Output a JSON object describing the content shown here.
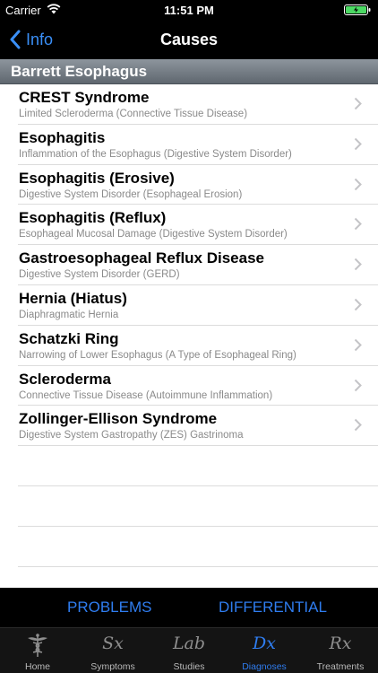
{
  "status_bar": {
    "carrier": "Carrier",
    "time": "11:51 PM"
  },
  "nav": {
    "back_label": "Info",
    "title": "Causes"
  },
  "section": {
    "header": "Barrett Esophagus"
  },
  "causes": [
    {
      "title": "CREST Syndrome",
      "subtitle": "Limited Scleroderma (Connective Tissue Disease)"
    },
    {
      "title": "Esophagitis",
      "subtitle": "Inflammation of the Esophagus (Digestive System Disorder)"
    },
    {
      "title": "Esophagitis (Erosive)",
      "subtitle": "Digestive System Disorder (Esophageal Erosion)"
    },
    {
      "title": "Esophagitis (Reflux)",
      "subtitle": "Esophageal Mucosal Damage (Digestive System Disorder)"
    },
    {
      "title": "Gastroesophageal Reflux Disease",
      "subtitle": "Digestive System Disorder (GERD)"
    },
    {
      "title": "Hernia (Hiatus)",
      "subtitle": "Diaphragmatic Hernia"
    },
    {
      "title": "Schatzki Ring",
      "subtitle": "Narrowing of Lower Esophagus (A Type of Esophageal Ring)"
    },
    {
      "title": "Scleroderma",
      "subtitle": "Connective Tissue Disease (Autoimmune Inflammation)"
    },
    {
      "title": "Zollinger-Ellison Syndrome",
      "subtitle": "Digestive System Gastropathy (ZES) Gastrinoma"
    }
  ],
  "segments": {
    "problems": "PROBLEMS",
    "differential": "DIFFERENTIAL"
  },
  "tabs": [
    {
      "label": "Home",
      "glyph": "",
      "icon": "caduceus-icon"
    },
    {
      "label": "Symptoms",
      "glyph": "Sx",
      "icon": "sx-icon"
    },
    {
      "label": "Studies",
      "glyph": "Lab",
      "icon": "lab-icon"
    },
    {
      "label": "Diagnoses",
      "glyph": "Dx",
      "icon": "dx-icon"
    },
    {
      "label": "Treatments",
      "glyph": "Rx",
      "icon": "rx-icon"
    }
  ],
  "colors": {
    "accent": "#2f7df0",
    "back_link": "#3a8ff7",
    "battery": "#4cd964"
  }
}
